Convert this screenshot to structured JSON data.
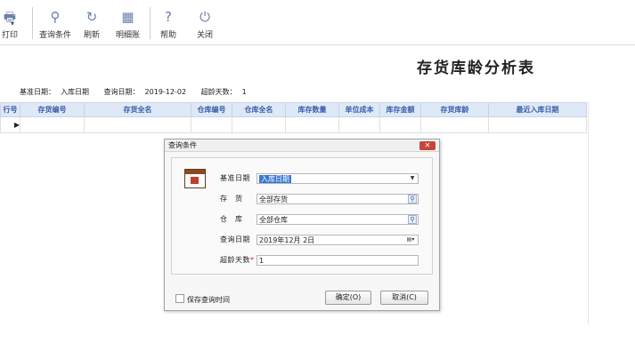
{
  "toolbar": {
    "print_label": "打印",
    "query_label": "查询条件",
    "refresh_label": "刷新",
    "detail_label": "明细账",
    "help_label": "帮助",
    "close_label": "关闭"
  },
  "report": {
    "title": "存货库龄分析表",
    "base_date_label": "基准日期：",
    "base_date_value": "入库日期",
    "query_date_label": "查询日期：",
    "query_date_value": "2019-12-02",
    "age_days_label": "超龄天数：",
    "age_days_value": "1"
  },
  "grid": {
    "columns": [
      "行号",
      "存货编号",
      "存货全名",
      "仓库编号",
      "仓库全名",
      "库存数量",
      "单位成本",
      "库存金额",
      "存货库龄",
      "最近入库日期"
    ],
    "current_row_marker": "▶"
  },
  "dialog": {
    "title": "查询条件",
    "close_label": "✕",
    "base_date_label": "基准日期",
    "base_date_value": "入库日期",
    "goods_label": "存　货",
    "goods_value": "全部存货",
    "warehouse_label": "仓　库",
    "warehouse_value": "全部仓库",
    "query_date_label": "查询日期",
    "query_date_value": "2019年12月 2日",
    "age_days_label": "超龄天数",
    "age_days_required": "*",
    "age_days_value": "1",
    "save_time_label": "保存查询时间",
    "ok_label": "确定(O)",
    "cancel_label": "取消(C)"
  }
}
